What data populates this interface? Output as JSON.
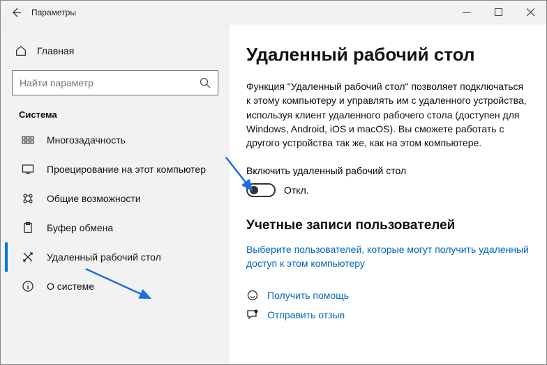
{
  "titlebar": {
    "title": "Параметры"
  },
  "sidebar": {
    "home_label": "Главная",
    "search_placeholder": "Найти параметр",
    "section_title": "Система",
    "items": [
      {
        "label": "Многозадачность"
      },
      {
        "label": "Проецирование на этот компьютер"
      },
      {
        "label": "Общие возможности"
      },
      {
        "label": "Буфер обмена"
      },
      {
        "label": "Удаленный рабочий стол"
      },
      {
        "label": "О системе"
      }
    ]
  },
  "content": {
    "heading": "Удаленный рабочий стол",
    "description": "Функция \"Удаленный рабочий стол\" позволяет подключаться к этому компьютеру и управлять им с удаленного устройства, используя клиент удаленного рабочего стола (доступен для Windows, Android, iOS и macOS). Вы сможете работать с другого устройства так же, как на этом компьютере.",
    "toggle_label": "Включить удаленный рабочий стол",
    "toggle_state": "Откл.",
    "accounts_heading": "Учетные записи пользователей",
    "accounts_link": "Выберите пользователей, которые могут получить удаленный доступ к этом компьютеру",
    "help_label": "Получить помощь",
    "feedback_label": "Отправить отзыв"
  }
}
